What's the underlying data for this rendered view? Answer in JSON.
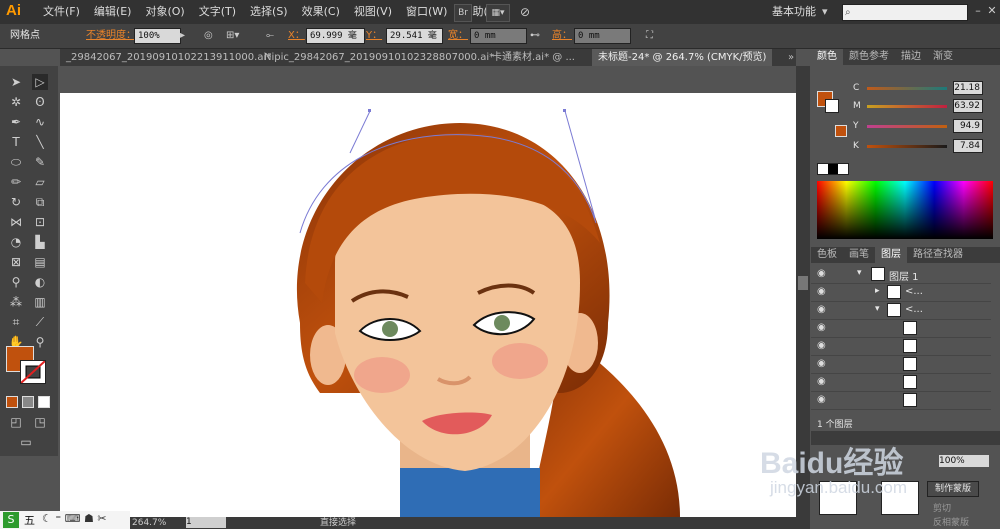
{
  "app": {
    "logo": "Ai"
  },
  "menu": [
    "文件(F)",
    "编辑(E)",
    "对象(O)",
    "文字(T)",
    "选择(S)",
    "效果(C)",
    "视图(V)",
    "窗口(W)",
    "帮助(H)"
  ],
  "menubar_buttons": {
    "bridge": "Br"
  },
  "workspace": {
    "label": "基本功能",
    "search_placeholder": ""
  },
  "control": {
    "selection_label": "网格点",
    "opacity_label": "不透明度：",
    "opacity_value": "100%",
    "x_label": "X：",
    "x_value": "69.999 毫",
    "y_label": "Y：",
    "y_value": "29.541 毫",
    "w_label": "宽：",
    "w_value": "0 mm",
    "h_label": "高：",
    "h_value": "0 mm"
  },
  "tabs": [
    {
      "label": "_29842067_20190910102213911000.ai*",
      "active": false
    },
    {
      "label": "Nipic_29842067_20190910102328807000.ai*",
      "active": false
    },
    {
      "label": "卡通素材.ai* @ ...",
      "active": false
    },
    {
      "label": "未标题-24* @ 264.7% (CMYK/预览)",
      "active": true
    }
  ],
  "color_panel": {
    "tabs": [
      "颜色",
      "颜色参考",
      "描边",
      "渐变"
    ],
    "channels": [
      {
        "name": "C",
        "value": "21.18",
        "fill": 0.21
      },
      {
        "name": "M",
        "value": "63.92",
        "fill": 0.64
      },
      {
        "name": "Y",
        "value": "94.9",
        "fill": 0.95
      },
      {
        "name": "K",
        "value": "7.84",
        "fill": 0.08
      }
    ],
    "fill_color": "#c0510d"
  },
  "layers_panel": {
    "tabs": [
      "色板",
      "画笔",
      "图层",
      "路径查找器"
    ],
    "layer_name": "图层 1",
    "sublayers": [
      "<...",
      "<..."
    ],
    "footer": "1 个图层"
  },
  "lower_panel": {
    "zoom": "100%",
    "make_mask": "制作蒙版",
    "clip": "剪切",
    "invert_mask": "反相蒙版"
  },
  "status": {
    "zoom": "264.7%",
    "page": "1",
    "tool": "直接选择"
  },
  "taskbar": {
    "ime": "五"
  },
  "watermark": {
    "brand": "Baidu经验",
    "url": "jingyan.baidu.com"
  },
  "colors": {
    "hair": "#c0510d",
    "skin": "#f3c49a",
    "blush": "#f0a68c",
    "lips": "#e25b5b",
    "shirt": "#2f6db5",
    "accent": "#ff9a00"
  }
}
